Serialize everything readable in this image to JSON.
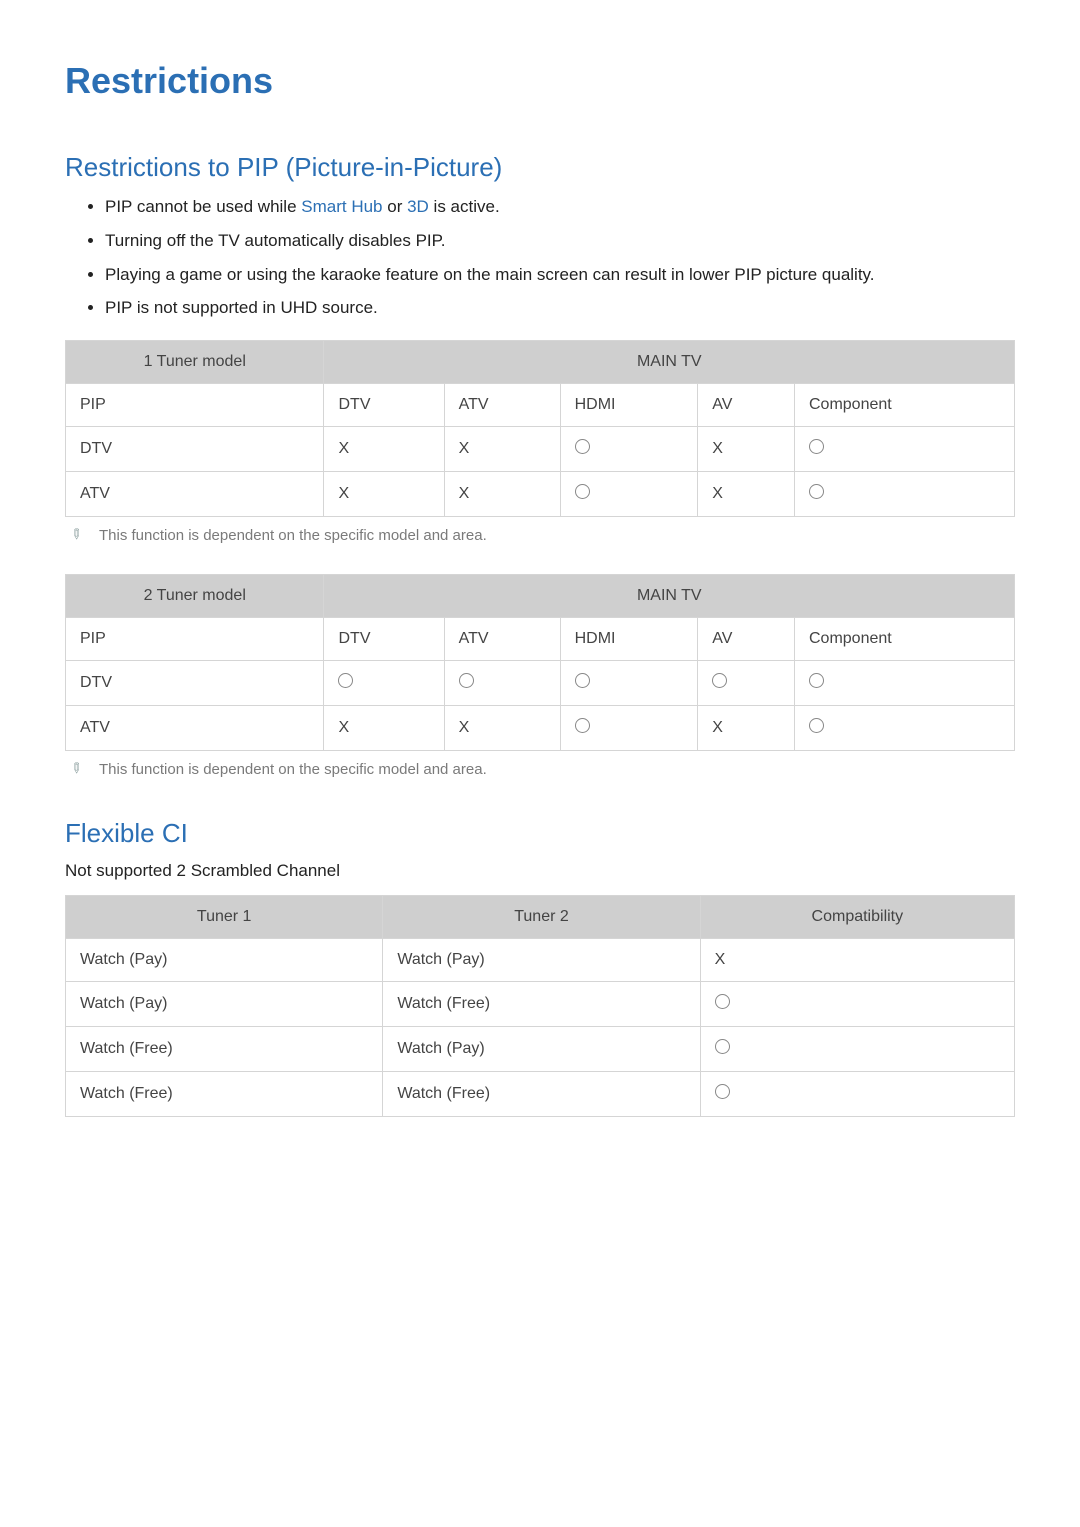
{
  "page_title": "Restrictions",
  "section_pip": {
    "heading": "Restrictions to PIP (Picture-in-Picture)",
    "bullets": [
      {
        "pre": "PIP cannot be used while ",
        "hl1": "Smart Hub",
        "mid": " or ",
        "hl2": "3D",
        "post": " is active."
      },
      {
        "text": "Turning off the TV automatically disables PIP."
      },
      {
        "text": "Playing a game or using the karaoke feature on the main screen can result in lower PIP picture quality."
      },
      {
        "text": "PIP is not supported in UHD source."
      }
    ],
    "table1": {
      "corner": "1 Tuner model",
      "span_header": "MAIN TV",
      "cols": [
        "PIP",
        "DTV",
        "ATV",
        "HDMI",
        "AV",
        "Component"
      ],
      "rows": [
        {
          "label": "DTV",
          "cells": [
            "X",
            "X",
            "O",
            "X",
            "O"
          ]
        },
        {
          "label": "ATV",
          "cells": [
            "X",
            "X",
            "O",
            "X",
            "O"
          ]
        }
      ],
      "note": "This function is dependent on the specific model and area."
    },
    "table2": {
      "corner": "2 Tuner model",
      "span_header": "MAIN TV",
      "cols": [
        "PIP",
        "DTV",
        "ATV",
        "HDMI",
        "AV",
        "Component"
      ],
      "rows": [
        {
          "label": "DTV",
          "cells": [
            "O",
            "O",
            "O",
            "O",
            "O"
          ]
        },
        {
          "label": "ATV",
          "cells": [
            "X",
            "X",
            "O",
            "X",
            "O"
          ]
        }
      ],
      "note": "This function is dependent on the specific model and area."
    }
  },
  "section_ci": {
    "heading": "Flexible CI",
    "subtext": "Not supported 2 Scrambled Channel",
    "headers": [
      "Tuner 1",
      "Tuner 2",
      "Compatibility"
    ],
    "rows": [
      [
        "Watch (Pay)",
        "Watch (Pay)",
        "X"
      ],
      [
        "Watch (Pay)",
        "Watch (Free)",
        "O"
      ],
      [
        "Watch (Free)",
        "Watch (Pay)",
        "O"
      ],
      [
        "Watch (Free)",
        "Watch (Free)",
        "O"
      ]
    ]
  }
}
